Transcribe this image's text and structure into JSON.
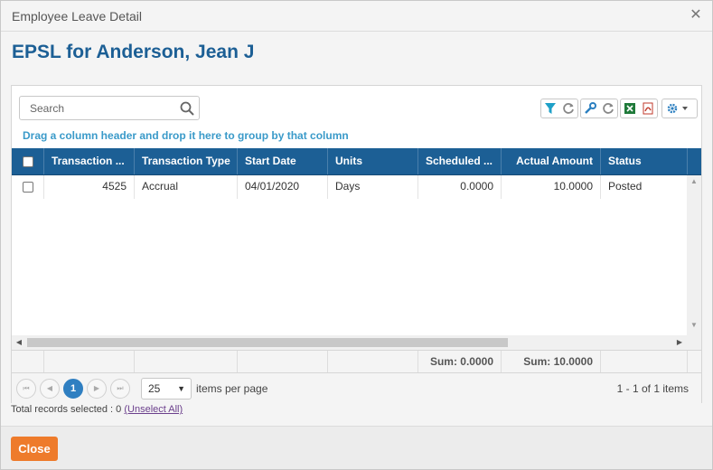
{
  "window": {
    "title": "Employee Leave Detail"
  },
  "page": {
    "heading": "EPSL for Anderson, Jean J"
  },
  "search": {
    "placeholder": "Search"
  },
  "grid": {
    "group_hint": "Drag a column header and drop it here to group by that column",
    "columns": [
      "Transaction ...",
      "Transaction Type",
      "Start Date",
      "Units",
      "Scheduled ...",
      "Actual Amount",
      "Status"
    ],
    "rows": [
      {
        "transaction": "4525",
        "type": "Accrual",
        "start_date": "04/01/2020",
        "units": "Days",
        "scheduled": "0.0000",
        "actual": "10.0000",
        "status": "Posted"
      }
    ],
    "footer": {
      "scheduled_sum": "Sum: 0.0000",
      "actual_sum": "Sum: 10.0000"
    }
  },
  "pager": {
    "current_page": "1",
    "page_size": "25",
    "items_per_page_label": "items per page",
    "info": "1 - 1 of 1 items"
  },
  "selection": {
    "label": "Total records selected : 0",
    "unselect_all": "(Unselect All)"
  },
  "actions": {
    "close_label": "Close"
  },
  "colors": {
    "header_bg": "#1c5f95",
    "accent_blue": "#3a9ac9",
    "close_orange": "#ee7b2b",
    "page_active": "#2f7fc1"
  }
}
